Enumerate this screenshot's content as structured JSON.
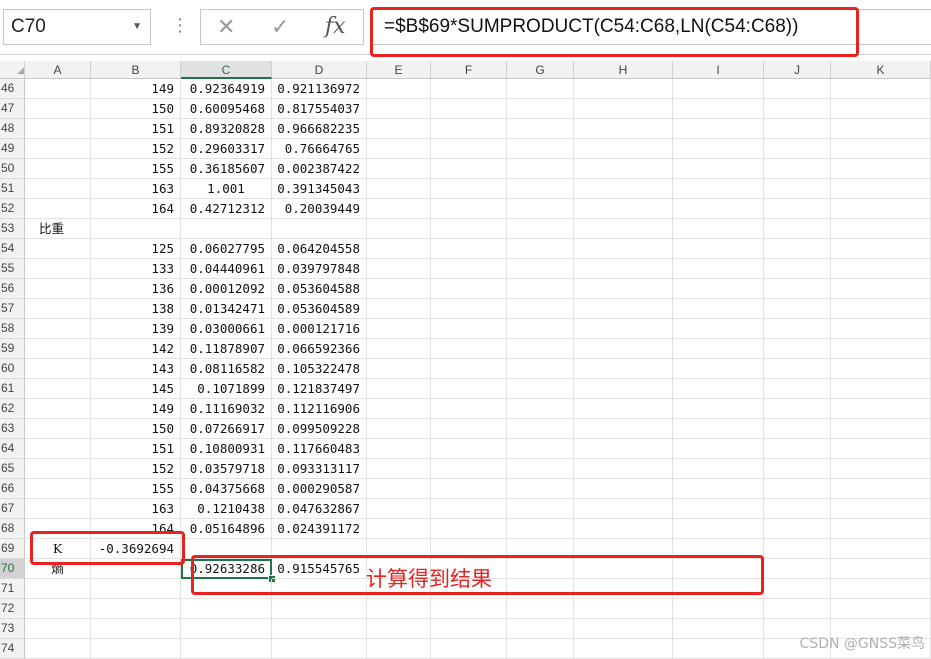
{
  "formula_bar": {
    "name_box": "C70",
    "cancel_icon": "✕",
    "enter_icon": "✓",
    "fx_icon": "fx",
    "formula": "=$B$69*SUMPRODUCT(C54:C68,LN(C54:C68))"
  },
  "columns": [
    "A",
    "B",
    "C",
    "D",
    "E",
    "F",
    "G",
    "H",
    "I",
    "J",
    "K"
  ],
  "selected_cell": "C70",
  "rows": [
    {
      "n": "46",
      "a": "",
      "b": "149",
      "c": "0.92364919",
      "d": "0.921136972"
    },
    {
      "n": "47",
      "a": "",
      "b": "150",
      "c": "0.60095468",
      "d": "0.817554037"
    },
    {
      "n": "48",
      "a": "",
      "b": "151",
      "c": "0.89320828",
      "d": "0.966682235"
    },
    {
      "n": "49",
      "a": "",
      "b": "152",
      "c": "0.29603317",
      "d": "0.76664765"
    },
    {
      "n": "50",
      "a": "",
      "b": "155",
      "c": "0.36185607",
      "d": "0.002387422"
    },
    {
      "n": "51",
      "a": "",
      "b": "163",
      "c": "1.001",
      "d": "0.391345043"
    },
    {
      "n": "52",
      "a": "",
      "b": "164",
      "c": "0.42712312",
      "d": "0.20039449"
    },
    {
      "n": "53",
      "a": "比重",
      "b": "",
      "c": "",
      "d": ""
    },
    {
      "n": "54",
      "a": "",
      "b": "125",
      "c": "0.06027795",
      "d": "0.064204558"
    },
    {
      "n": "55",
      "a": "",
      "b": "133",
      "c": "0.04440961",
      "d": "0.039797848"
    },
    {
      "n": "56",
      "a": "",
      "b": "136",
      "c": "0.00012092",
      "d": "0.053604588"
    },
    {
      "n": "57",
      "a": "",
      "b": "138",
      "c": "0.01342471",
      "d": "0.053604589"
    },
    {
      "n": "58",
      "a": "",
      "b": "139",
      "c": "0.03000661",
      "d": "0.000121716"
    },
    {
      "n": "59",
      "a": "",
      "b": "142",
      "c": "0.11878907",
      "d": "0.066592366"
    },
    {
      "n": "60",
      "a": "",
      "b": "143",
      "c": "0.08116582",
      "d": "0.105322478"
    },
    {
      "n": "61",
      "a": "",
      "b": "145",
      "c": "0.1071899",
      "d": "0.121837497"
    },
    {
      "n": "62",
      "a": "",
      "b": "149",
      "c": "0.11169032",
      "d": "0.112116906"
    },
    {
      "n": "63",
      "a": "",
      "b": "150",
      "c": "0.07266917",
      "d": "0.099509228"
    },
    {
      "n": "64",
      "a": "",
      "b": "151",
      "c": "0.10800931",
      "d": "0.117660483"
    },
    {
      "n": "65",
      "a": "",
      "b": "152",
      "c": "0.03579718",
      "d": "0.093313117"
    },
    {
      "n": "66",
      "a": "",
      "b": "155",
      "c": "0.04375668",
      "d": "0.000290587"
    },
    {
      "n": "67",
      "a": "",
      "b": "163",
      "c": "0.1210438",
      "d": "0.047632867"
    },
    {
      "n": "68",
      "a": "",
      "b": "164",
      "c": "0.05164896",
      "d": "0.024391172"
    },
    {
      "n": "69",
      "a": "K",
      "b": "-0.3692694",
      "c": "",
      "d": ""
    },
    {
      "n": "70",
      "a": "熵",
      "b": "",
      "c": "0.92633286",
      "d": "0.915545765"
    },
    {
      "n": "71",
      "a": "",
      "b": "",
      "c": "",
      "d": ""
    },
    {
      "n": "72",
      "a": "",
      "b": "",
      "c": "",
      "d": ""
    },
    {
      "n": "73",
      "a": "",
      "b": "",
      "c": "",
      "d": ""
    },
    {
      "n": "74",
      "a": "",
      "b": "",
      "c": "",
      "d": ""
    }
  ],
  "annotation": "计算得到结果",
  "watermark": "CSDN @GNSS菜鸟",
  "colors": {
    "highlight": "#e8231f",
    "selection": "#217346"
  }
}
